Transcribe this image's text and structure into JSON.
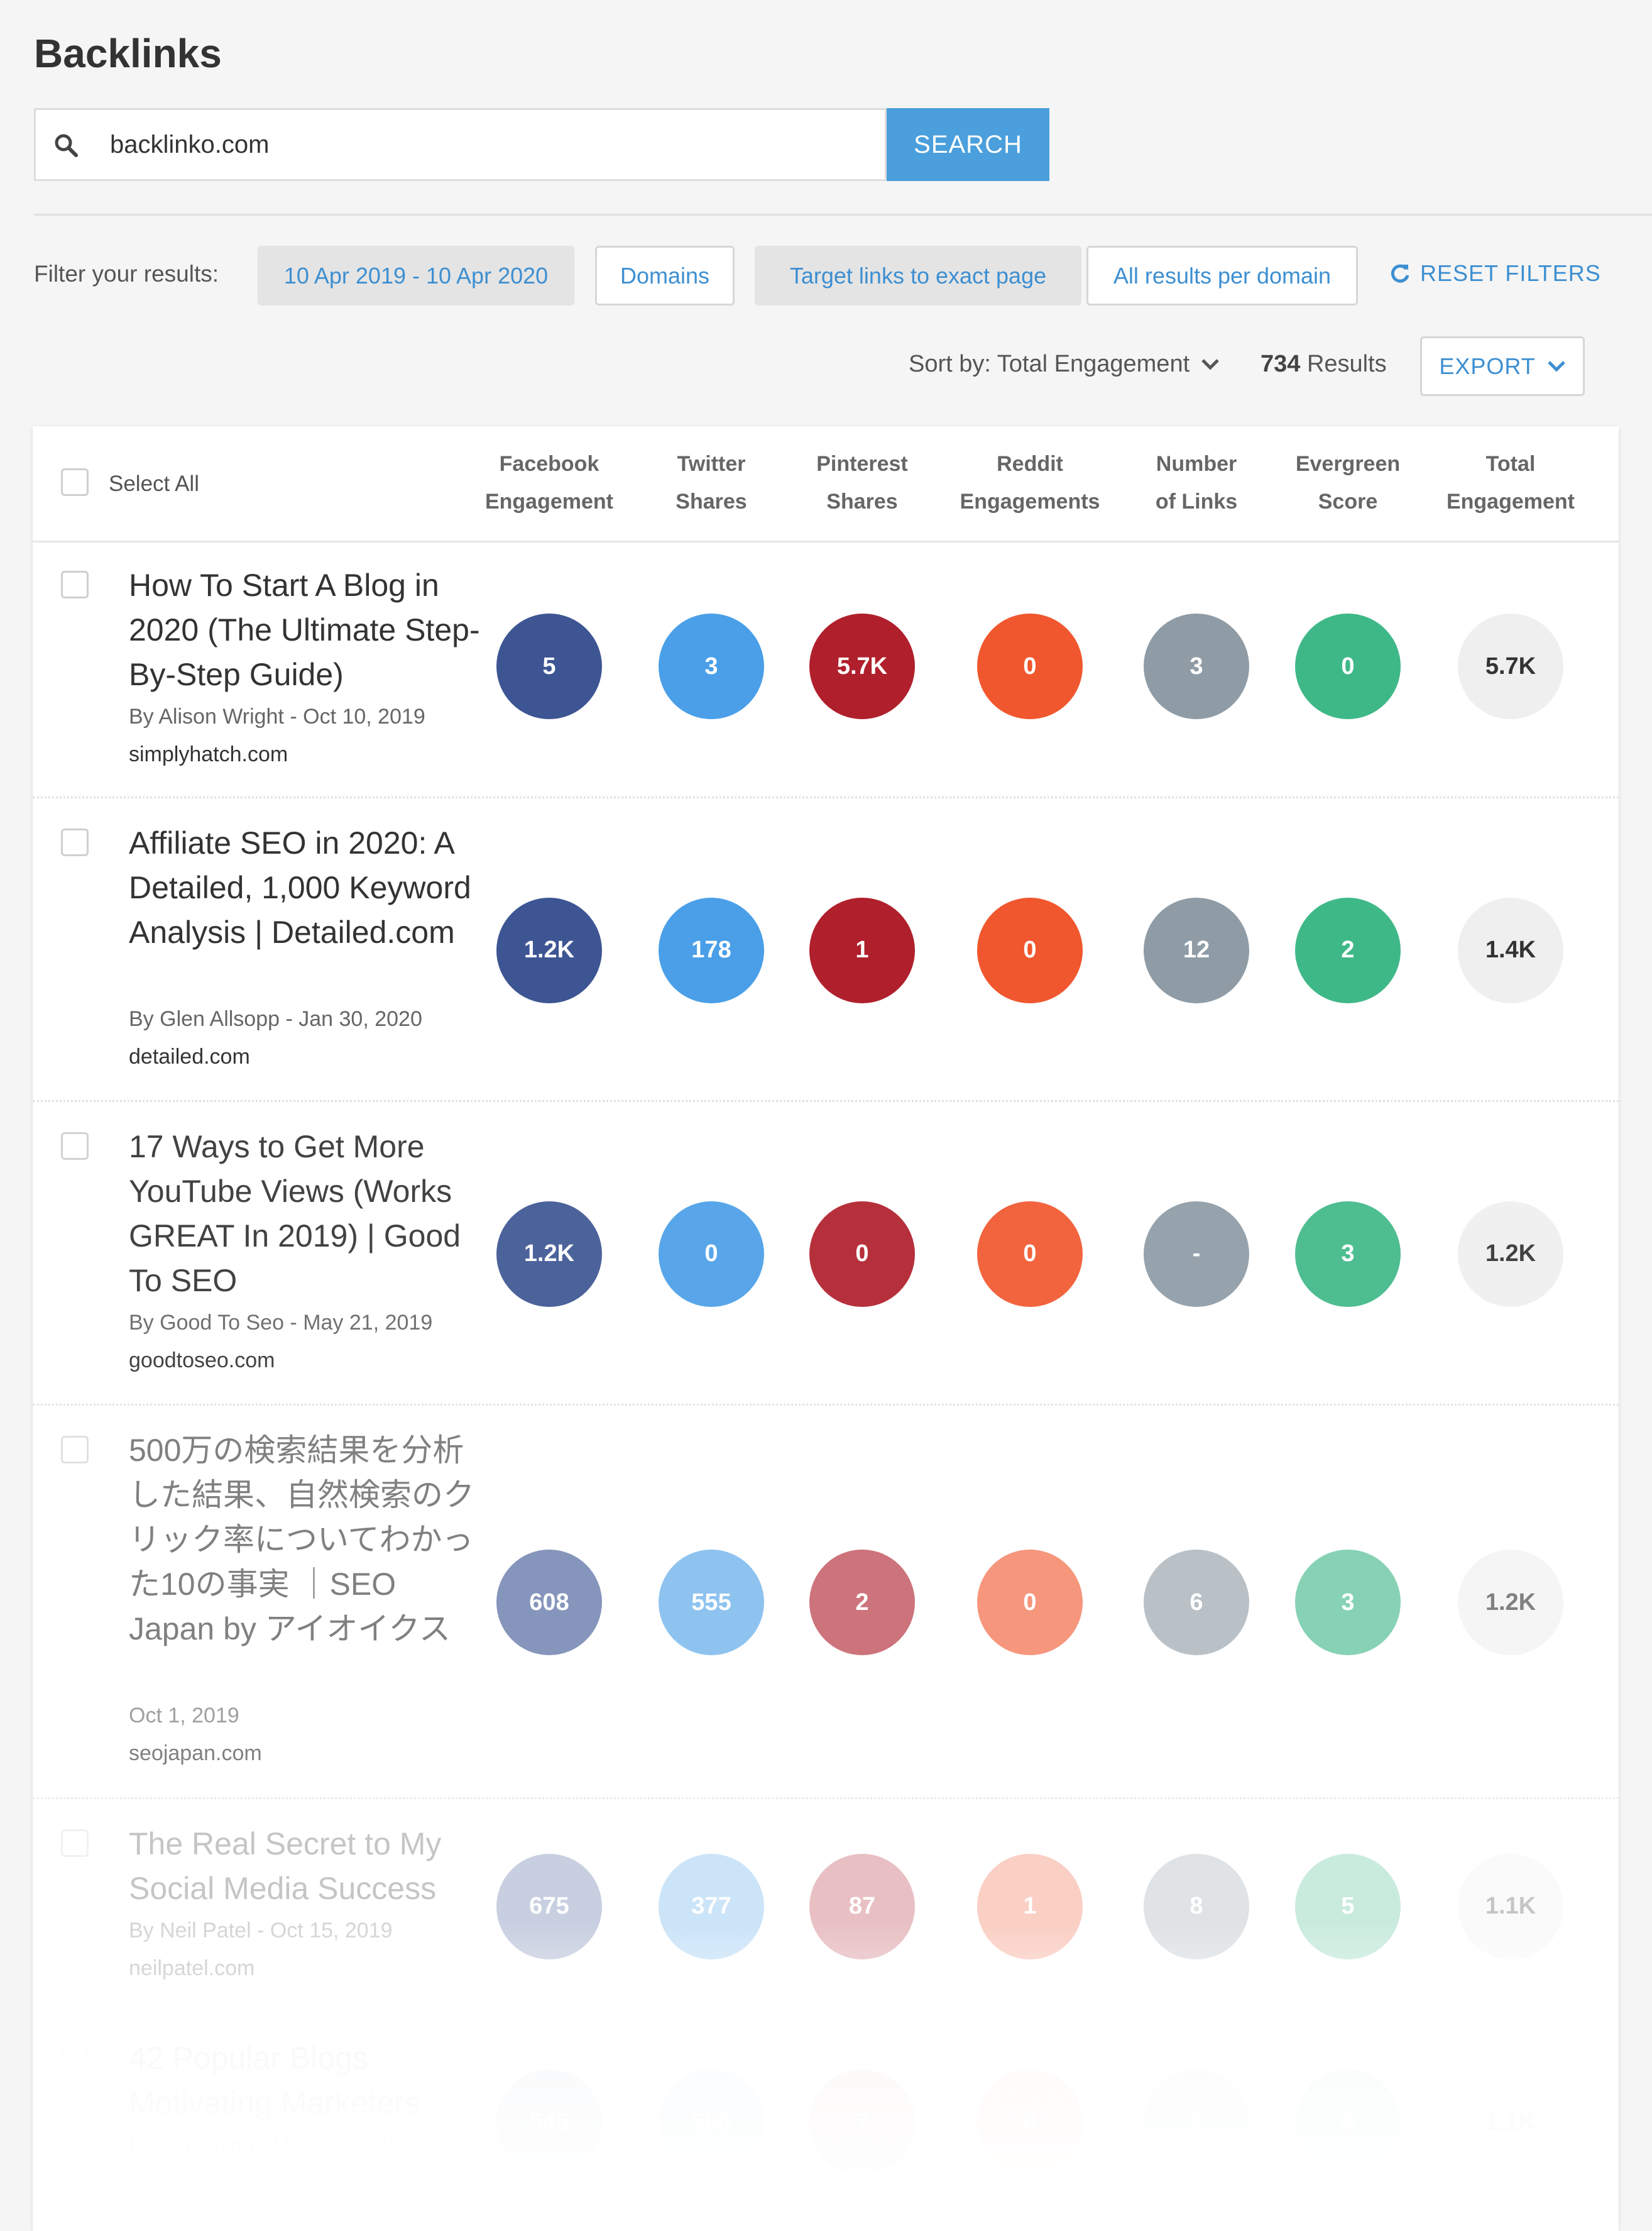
{
  "page": {
    "title": "Backlinks"
  },
  "search": {
    "value": "backlinko.com",
    "button_label": "SEARCH"
  },
  "filters": {
    "label": "Filter your results:",
    "chips": [
      "10 Apr 2019 - 10 Apr 2020",
      "Domains",
      "Target links to exact page",
      "All results per domain"
    ],
    "active": [
      true,
      false,
      true,
      false
    ],
    "reset_label": "RESET FILTERS"
  },
  "toolbar": {
    "sort_label": "Sort by: Total Engagement",
    "results_count": "734",
    "results_label": "Results",
    "export_label": "EXPORT"
  },
  "table": {
    "select_all_label": "Select All",
    "columns": [
      {
        "line1": "Facebook",
        "line2": "Engagement"
      },
      {
        "line1": "Twitter",
        "line2": "Shares"
      },
      {
        "line1": "Pinterest",
        "line2": "Shares"
      },
      {
        "line1": "Reddit",
        "line2": "Engagements"
      },
      {
        "line1": "Number",
        "line2": "of Links"
      },
      {
        "line1": "Evergreen",
        "line2": "Score"
      },
      {
        "line1": "Total",
        "line2": "Engagement"
      }
    ],
    "metric_colors": [
      "#3d5593",
      "#4a9fe8",
      "#b01f2c",
      "#f0572e",
      "#8f9ca6",
      "#3fb887",
      "#efefef"
    ],
    "rows": [
      {
        "title": "How To Start A Blog in 2020 (The Ultimate Step-By-Step Guide)",
        "meta": "By Alison Wright - Oct 10, 2019",
        "domain": "simplyhatch.com",
        "values": [
          "5",
          "3",
          "5.7K",
          "0",
          "3",
          "0",
          "5.7K"
        ]
      },
      {
        "title": "Affiliate SEO in 2020: A Detailed, 1,000 Keyword Analysis | Detailed.com",
        "meta": "By Glen Allsopp - Jan 30, 2020",
        "domain": "detailed.com",
        "values": [
          "1.2K",
          "178",
          "1",
          "0",
          "12",
          "2",
          "1.4K"
        ]
      },
      {
        "title": "17 Ways to Get More YouTube Views (Works GREAT In 2019) | Good To SEO",
        "meta": "By Good To Seo - May 21, 2019",
        "domain": "goodtoseo.com",
        "values": [
          "1.2K",
          "0",
          "0",
          "0",
          "-",
          "3",
          "1.2K"
        ]
      },
      {
        "title": "500万の検索結果を分析した結果、自然検索のクリック率についてわかった10の事実 ｜SEO Japan by アイオイクス",
        "meta": "Oct 1, 2019",
        "domain": "seojapan.com",
        "values": [
          "608",
          "555",
          "2",
          "0",
          "6",
          "3",
          "1.2K"
        ]
      },
      {
        "title": "The Real Secret to My Social Media Success",
        "meta": "By Neil Patel - Oct 15, 2019",
        "domain": "neilpatel.com",
        "values": [
          "675",
          "377",
          "87",
          "1",
          "8",
          "5",
          "1.1K"
        ]
      },
      {
        "title": "42 Popular Blogs Motivating Marketers",
        "meta": "By Ann Gynn - May 30, 2019",
        "domain": "contentmarketinginstitute.com",
        "values": [
          "545",
          "580",
          "7",
          "0",
          "7",
          "8",
          "1.1K"
        ]
      }
    ]
  }
}
